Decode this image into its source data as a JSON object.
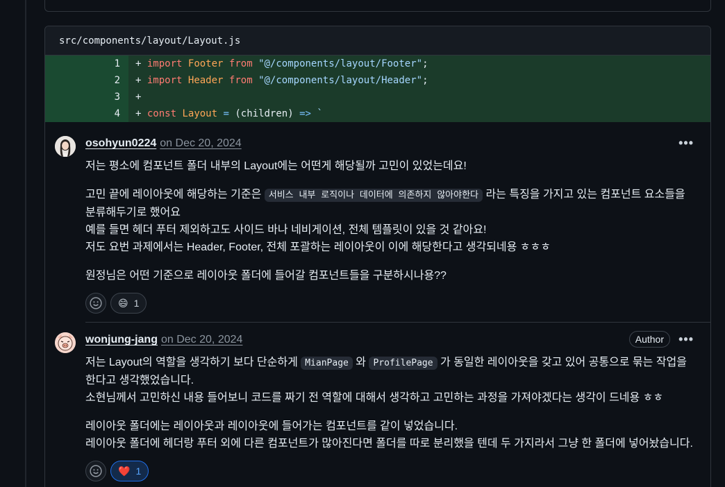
{
  "file": {
    "path": "src/components/layout/Layout.js",
    "lines": [
      {
        "num": "1",
        "plus": "+",
        "kw": "import",
        "id": "Footer",
        "kw2": "from",
        "str": "\"@/components/layout/Footer\"",
        "end": ";"
      },
      {
        "num": "2",
        "plus": "+",
        "kw": "import",
        "id": "Header",
        "kw2": "from",
        "str": "\"@/components/layout/Header\"",
        "end": ";"
      },
      {
        "num": "3",
        "plus": "+"
      },
      {
        "num": "4",
        "plus": "+",
        "kw": "const",
        "id": "Layout",
        "op1": "=",
        "args": "(children)",
        "op2": "=>",
        "tick": "`"
      }
    ]
  },
  "comments": [
    {
      "author": "osohyun0224",
      "date": "on Dec 20, 2024",
      "menu": "•••",
      "p1": "저는 평소에 컴포넌트 폴더 내부의 Layout에는 어떤게 해당될까 고민이 있었는데요!",
      "p2_before": "고민 끝에 레이아웃에 해당하는 기준은 ",
      "p2_code": "서비스 내부 로직이나 데이터에 의존하지 않아야한다",
      "p2_after": " 라는 특징을 가지고 있는 컴포넌트 요소들을 분류해두기로 했어요",
      "p3": "예를 들면 헤더 푸터 제외하고도 사이드 바나 네비게이션, 전체 템플릿이 있을 것 같아요!",
      "p4": "저도 요번 과제에서는 Header, Footer, 전체 포괄하는 레이아웃이 이에 해당한다고 생각되네용 ㅎㅎㅎ",
      "p5": "원정님은 어떤 기준으로 레이아웃 폴더에 들어갈 컴포넌트들을 구분하시나용??",
      "reaction_emoji": "😄",
      "reaction_count": "1"
    },
    {
      "author": "wonjung-jang",
      "date": "on Dec 20, 2024",
      "badge": "Author",
      "menu": "•••",
      "p1_a": "저는 Layout의 역할을 생각하기 보다 단순하게 ",
      "p1_code1": "MianPage",
      "p1_b": " 와 ",
      "p1_code2": "ProfilePage",
      "p1_c": " 가 동일한 레이아웃을 갖고 있어 공통으로 묶는 작업을 한다고 생각했었습니다.",
      "p2": "소현님께서 고민하신 내용 들어보니 코드를 짜기 전 역할에 대해서 생각하고 고민하는 과정을 가져야겠다는 생각이 드네용 ㅎㅎ",
      "p3": "레이아웃 폴더에는 레이아웃과 레이아웃에 들어가는 컴포넌트를 같이 넣었습니다.",
      "p4": "레이아웃 폴더에 헤더랑 푸터 외에 다른 컴포넌트가 많아진다면 폴더를 따로 분리했을 텐데 두 가지라서 그냥 한 폴더에 넣어놨습니다.",
      "reaction_emoji": "❤️",
      "reaction_count": "1"
    }
  ],
  "icons": {
    "add_reaction": "smiley-icon",
    "menu": "kebab-icon"
  }
}
